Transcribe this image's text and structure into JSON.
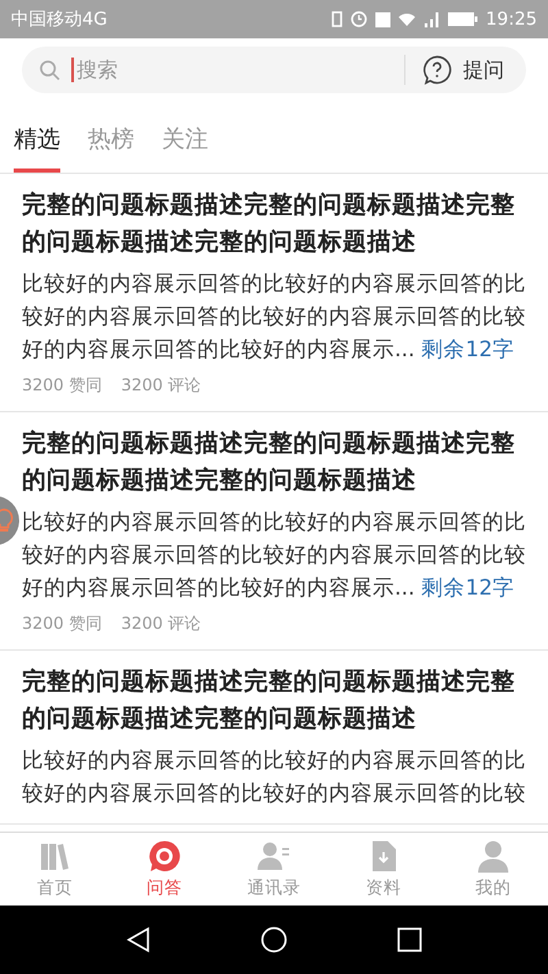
{
  "status_bar": {
    "carrier": "中国移动4G",
    "time": "19:25"
  },
  "search": {
    "placeholder": "搜索",
    "ask_button": "提问"
  },
  "tabs": [
    {
      "label": "精选",
      "selected": true
    },
    {
      "label": "热榜",
      "selected": false
    },
    {
      "label": "关注",
      "selected": false
    }
  ],
  "cards": [
    {
      "title": "完整的问题标题描述完整的问题标题描述完整的问题标题描述完整的问题标题描述",
      "body": "比较好的内容展示回答的比较好的内容展示回答的比较好的内容展示回答的比较好的内容展示回答的比较好的内容展示回答的比较好的内容展示...",
      "more": "剩余12字",
      "likes": "3200 赞同",
      "comments": "3200 评论"
    },
    {
      "title": "完整的问题标题描述完整的问题标题描述完整的问题标题描述完整的问题标题描述",
      "body": "比较好的内容展示回答的比较好的内容展示回答的比较好的内容展示回答的比较好的内容展示回答的比较好的内容展示回答的比较好的内容展示...",
      "more": "剩余12字",
      "likes": "3200 赞同",
      "comments": "3200 评论"
    },
    {
      "title": "完整的问题标题描述完整的问题标题描述完整的问题标题描述完整的问题标题描述",
      "body": "比较好的内容展示回答的比较好的内容展示回答的比较好的内容展示回答的比较好的内容展示回答的比较"
    }
  ],
  "bottom_tabs": [
    {
      "label": "首页",
      "kind": "books",
      "selected": false
    },
    {
      "label": "问答",
      "kind": "chat",
      "selected": true
    },
    {
      "label": "通讯录",
      "kind": "contacts",
      "selected": false
    },
    {
      "label": "资料",
      "kind": "file",
      "selected": false
    },
    {
      "label": "我的",
      "kind": "person",
      "selected": false
    }
  ]
}
